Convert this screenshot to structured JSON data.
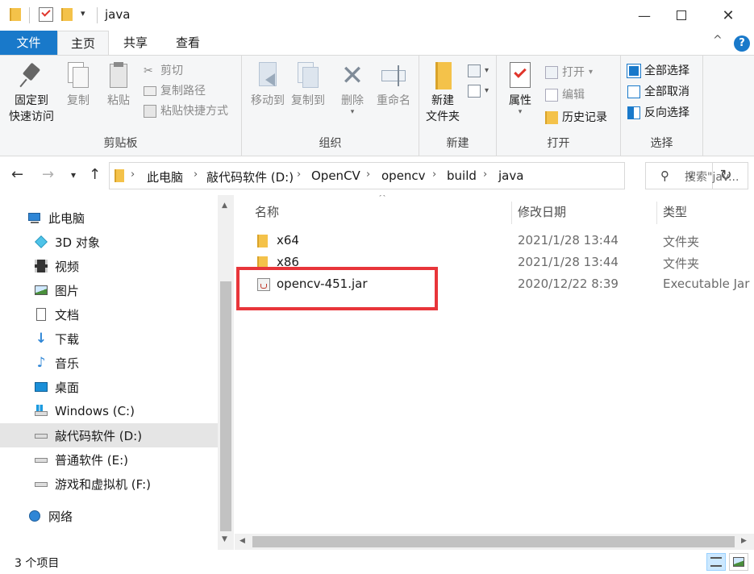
{
  "window": {
    "title": "java",
    "minimize_icon": "minimize-icon",
    "maximize_icon": "maximize-icon",
    "close_icon": "close-icon"
  },
  "ribbon_tabs": [
    {
      "label": "文件"
    },
    {
      "label": "主页"
    },
    {
      "label": "共享"
    },
    {
      "label": "查看"
    }
  ],
  "ribbon": {
    "clipboard": {
      "label": "剪贴板",
      "pin_line1": "固定到",
      "pin_line2": "快速访问",
      "copy": "复制",
      "paste": "粘贴",
      "cut": "剪切",
      "copy_path": "复制路径",
      "paste_shortcut": "粘贴快捷方式"
    },
    "organize": {
      "label": "组织",
      "move_to": "移动到",
      "copy_to": "复制到",
      "delete": "删除",
      "rename": "重命名"
    },
    "new": {
      "label": "新建",
      "new_folder_line1": "新建",
      "new_folder_line2": "文件夹"
    },
    "open": {
      "label": "打开",
      "properties": "属性",
      "open": "打开",
      "edit": "编辑",
      "history": "历史记录"
    },
    "select": {
      "label": "选择",
      "select_all": "全部选择",
      "select_none": "全部取消",
      "invert": "反向选择"
    }
  },
  "address": {
    "crumbs": [
      "此电脑",
      "敲代码软件 (D:)",
      "OpenCV",
      "opencv",
      "build",
      "java"
    ],
    "search_placeholder": "搜索\"jav..."
  },
  "nav_pane": {
    "items": [
      {
        "label": "此电脑",
        "icon": "computer-icon"
      },
      {
        "label": "3D 对象",
        "icon": "3d-objects-icon"
      },
      {
        "label": "视频",
        "icon": "video-icon"
      },
      {
        "label": "图片",
        "icon": "pictures-icon"
      },
      {
        "label": "文档",
        "icon": "documents-icon"
      },
      {
        "label": "下载",
        "icon": "download-icon"
      },
      {
        "label": "音乐",
        "icon": "music-icon"
      },
      {
        "label": "桌面",
        "icon": "desktop-icon"
      },
      {
        "label": "Windows (C:)",
        "icon": "windows-drive-icon"
      },
      {
        "label": "敲代码软件 (D:)",
        "icon": "drive-icon"
      },
      {
        "label": "普通软件 (E:)",
        "icon": "drive-icon"
      },
      {
        "label": "游戏和虚拟机 (F:)",
        "icon": "drive-icon"
      },
      {
        "label": "网络",
        "icon": "network-icon"
      }
    ]
  },
  "file_list": {
    "columns": [
      "名称",
      "修改日期",
      "类型"
    ],
    "rows": [
      {
        "name": "x64",
        "date": "2021/1/28 13:44",
        "type": "文件夹"
      },
      {
        "name": "x86",
        "date": "2021/1/28 13:44",
        "type": "文件夹"
      },
      {
        "name": "opencv-451.jar",
        "date": "2020/12/22 8:39",
        "type": "Executable Jar File"
      }
    ]
  },
  "status": {
    "count": "3 个项目"
  },
  "colors": {
    "accent": "#1979ca",
    "highlight": "#e8353a",
    "folder": "#f4c24a"
  }
}
